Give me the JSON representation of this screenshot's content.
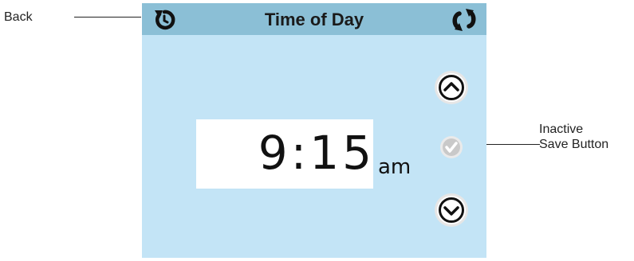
{
  "annotations": {
    "back": "Back",
    "inactive_save": "Inactive\nSave Button"
  },
  "screen": {
    "title": "Time of Day"
  },
  "time": {
    "value": "9:15",
    "period": "am"
  },
  "icons": {
    "back": "back-arrow-icon",
    "cycle": "cycle-arrows-icon",
    "up": "chevron-up-icon",
    "save": "checkmark-icon",
    "down": "chevron-down-icon"
  },
  "state": {
    "save_enabled": false
  },
  "colors": {
    "screen_bg": "#c3e4f6",
    "titlebar_bg": "#8bbfd6",
    "inactive_button": "#c9c9c9"
  }
}
